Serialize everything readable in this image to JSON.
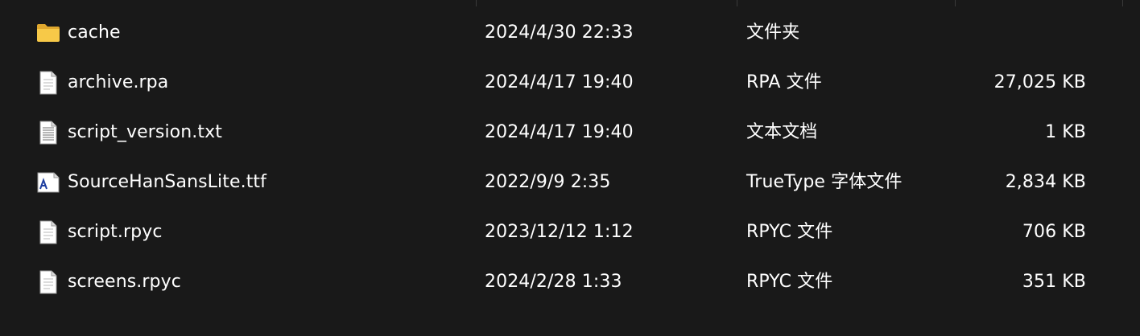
{
  "file_list": {
    "rows": [
      {
        "name": "cache",
        "date": "2024/4/30 22:33",
        "type": "文件夹",
        "size": "",
        "icon": "folder-icon"
      },
      {
        "name": "archive.rpa",
        "date": "2024/4/17 19:40",
        "type": "RPA 文件",
        "size": "27,025 KB",
        "icon": "file-icon"
      },
      {
        "name": "script_version.txt",
        "date": "2024/4/17 19:40",
        "type": "文本文档",
        "size": "1 KB",
        "icon": "text-file-icon"
      },
      {
        "name": "SourceHanSansLite.ttf",
        "date": "2022/9/9 2:35",
        "type": "TrueType 字体文件",
        "size": "2,834 KB",
        "icon": "font-file-icon"
      },
      {
        "name": "script.rpyc",
        "date": "2023/12/12 1:12",
        "type": "RPYC 文件",
        "size": "706 KB",
        "icon": "file-icon"
      },
      {
        "name": "screens.rpyc",
        "date": "2024/2/28 1:33",
        "type": "RPYC 文件",
        "size": "351 KB",
        "icon": "file-icon"
      }
    ]
  },
  "colors": {
    "background": "#191919",
    "text": "#ffffff",
    "folder": "#f7c948",
    "folder_dark": "#e0a82e"
  }
}
